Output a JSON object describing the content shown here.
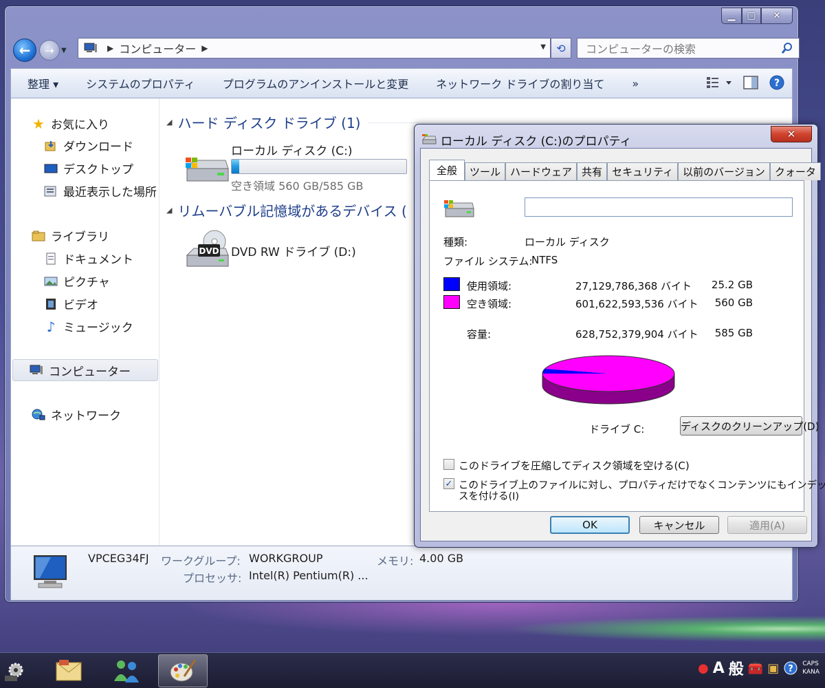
{
  "explorer": {
    "address": {
      "crumb": "コンピューター"
    },
    "search_placeholder": "コンピューターの検索",
    "toolbar": {
      "organize": "整理 ▾",
      "system_properties": "システムのプロパティ",
      "uninstall": "プログラムのアンインストールと変更",
      "map_drive": "ネットワーク ドライブの割り当て",
      "more": "»"
    },
    "nav": {
      "favorites": "お気に入り",
      "downloads": "ダウンロード",
      "desktop": "デスクトップ",
      "recent": "最近表示した場所",
      "libraries": "ライブラリ",
      "documents": "ドキュメント",
      "pictures": "ピクチャ",
      "videos": "ビデオ",
      "music": "ミュージック",
      "computer": "コンピューター",
      "network": "ネットワーク"
    },
    "content": {
      "hdd_group": "ハード ディスク ドライブ (1)",
      "local_disk_name": "ローカル ディスク (C:)",
      "local_disk_free": "空き領域 560 GB/585 GB",
      "local_disk_used_fraction": 0.043,
      "removable_group": "リムーバブル記憶域があるデバイス (",
      "dvd_name": "DVD RW ドライブ (D:)",
      "dvd_label": "DVD"
    },
    "details": {
      "computer_name": "VPCEG34FJ",
      "workgroup_label": "ワークグループ:",
      "workgroup_value": "WORKGROUP",
      "memory_label": "メモリ:",
      "memory_value": "4.00 GB",
      "processor_label": "プロセッサ:",
      "processor_value": "Intel(R) Pentium(R) ..."
    }
  },
  "dialog": {
    "title": "ローカル ディスク (C:)のプロパティ",
    "tabs": [
      "全般",
      "ツール",
      "ハードウェア",
      "共有",
      "セキュリティ",
      "以前のバージョン",
      "クォータ"
    ],
    "name_value": "",
    "type_label": "種類:",
    "type_value": "ローカル ディスク",
    "fs_label": "ファイル システム:",
    "fs_value": "NTFS",
    "used_label": "使用領域:",
    "used_bytes": "27,129,786,368 バイト",
    "used_gb": "25.2 GB",
    "free_label": "空き領域:",
    "free_bytes": "601,622,593,536 バイト",
    "free_gb": "560 GB",
    "capacity_label": "容量:",
    "capacity_bytes": "628,752,379,904 バイト",
    "capacity_gb": "585 GB",
    "drive_label": "ドライブ C:",
    "cleanup_button": "ディスクのクリーンアップ(D)",
    "compress_label": "このドライブを圧縮してディスク領域を空ける(C)",
    "index_label_line1": "このドライブ上のファイルに対し、プロパティだけでなくコンテンツにもインデック",
    "index_label_line2": "スを付ける(I)",
    "compress_checked": false,
    "index_checked": true,
    "ok": "OK",
    "cancel": "キャンセル",
    "apply": "適用(A)",
    "colors": {
      "used": "#0000ff",
      "free": "#ff00ff"
    },
    "used_fraction": 0.043
  },
  "tray": {
    "ime_a": "A",
    "ime_mode": "般",
    "caps": "CAPS",
    "kana": "KANA"
  }
}
